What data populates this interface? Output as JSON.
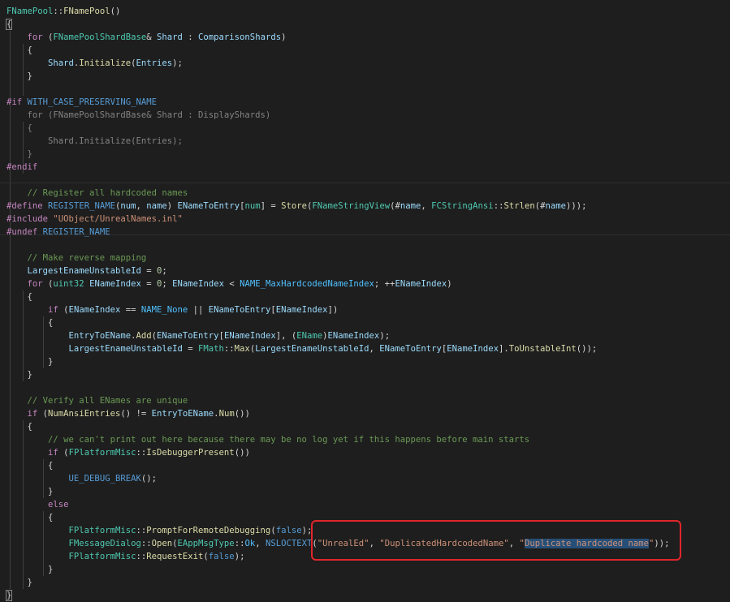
{
  "colors": {
    "background": "#1e1e1e",
    "highlight_border": "#e0262b",
    "selection": "#264f78"
  },
  "code": {
    "lines": [
      [
        {
          "t": "FNamePool",
          "c": "type"
        },
        {
          "t": "::",
          "c": "punc"
        },
        {
          "t": "FNamePool",
          "c": "fn"
        },
        {
          "t": "()",
          "c": "punc"
        }
      ],
      [
        {
          "t": "{",
          "c": "punc",
          "cursor": true
        }
      ],
      [
        {
          "t": "    "
        },
        {
          "t": "for",
          "c": "ctl"
        },
        {
          "t": " ("
        },
        {
          "t": "FNamePoolShardBase",
          "c": "type"
        },
        {
          "t": "& "
        },
        {
          "t": "Shard",
          "c": "var"
        },
        {
          "t": " : "
        },
        {
          "t": "ComparisonShards",
          "c": "var"
        },
        {
          "t": ")"
        }
      ],
      [
        {
          "t": "    {"
        }
      ],
      [
        {
          "t": "        "
        },
        {
          "t": "Shard",
          "c": "var"
        },
        {
          "t": "."
        },
        {
          "t": "Initialize",
          "c": "fn"
        },
        {
          "t": "("
        },
        {
          "t": "Entries",
          "c": "var"
        },
        {
          "t": ");"
        }
      ],
      [
        {
          "t": "    }"
        }
      ],
      [],
      [
        {
          "t": "#if",
          "c": "pre"
        },
        {
          "t": " WITH_CASE_PRESERVING_NAME",
          "c": "mac"
        }
      ],
      [
        {
          "t": "    for (FNamePoolShardBase& Shard : DisplayShards)",
          "dim": true
        }
      ],
      [
        {
          "t": "    {",
          "dim": true
        }
      ],
      [
        {
          "t": "        Shard.Initialize(Entries);",
          "dim": true
        }
      ],
      [
        {
          "t": "    }",
          "dim": true
        }
      ],
      [
        {
          "t": "#endif",
          "c": "pre"
        }
      ],
      [],
      [
        {
          "t": "    "
        },
        {
          "t": "// Register all hardcoded names",
          "c": "com"
        }
      ],
      [
        {
          "t": "#define",
          "c": "pre"
        },
        {
          "t": " "
        },
        {
          "t": "REGISTER_NAME",
          "c": "mac"
        },
        {
          "t": "("
        },
        {
          "t": "num",
          "c": "param"
        },
        {
          "t": ", "
        },
        {
          "t": "name",
          "c": "param"
        },
        {
          "t": ") "
        },
        {
          "t": "ENameToEntry",
          "c": "var"
        },
        {
          "t": "["
        },
        {
          "t": "num",
          "c": "type"
        },
        {
          "t": "] = "
        },
        {
          "t": "Store",
          "c": "fn"
        },
        {
          "t": "("
        },
        {
          "t": "FNameStringView",
          "c": "type"
        },
        {
          "t": "(#"
        },
        {
          "t": "name",
          "c": "param"
        },
        {
          "t": ", "
        },
        {
          "t": "FCStringAnsi",
          "c": "type"
        },
        {
          "t": "::"
        },
        {
          "t": "Strlen",
          "c": "fn"
        },
        {
          "t": "(#"
        },
        {
          "t": "name",
          "c": "param"
        },
        {
          "t": ")));"
        }
      ],
      [
        {
          "t": "#include",
          "c": "pre"
        },
        {
          "t": " "
        },
        {
          "t": "\"UObject/UnrealNames.inl\"",
          "c": "str"
        }
      ],
      [
        {
          "t": "#undef",
          "c": "pre"
        },
        {
          "t": " REGISTER_NAME",
          "c": "mac"
        }
      ],
      [],
      [
        {
          "t": "    "
        },
        {
          "t": "// Make reverse mapping",
          "c": "com"
        }
      ],
      [
        {
          "t": "    "
        },
        {
          "t": "LargestEnameUnstableId",
          "c": "var"
        },
        {
          "t": " = "
        },
        {
          "t": "0",
          "c": "num"
        },
        {
          "t": ";"
        }
      ],
      [
        {
          "t": "    "
        },
        {
          "t": "for",
          "c": "ctl"
        },
        {
          "t": " ("
        },
        {
          "t": "uint32",
          "c": "type"
        },
        {
          "t": " "
        },
        {
          "t": "ENameIndex",
          "c": "var"
        },
        {
          "t": " = "
        },
        {
          "t": "0",
          "c": "num"
        },
        {
          "t": "; "
        },
        {
          "t": "ENameIndex",
          "c": "var"
        },
        {
          "t": " < "
        },
        {
          "t": "NAME_MaxHardcodedNameIndex",
          "c": "enum"
        },
        {
          "t": "; ++"
        },
        {
          "t": "ENameIndex",
          "c": "var"
        },
        {
          "t": ")"
        }
      ],
      [
        {
          "t": "    {"
        }
      ],
      [
        {
          "t": "        "
        },
        {
          "t": "if",
          "c": "ctl"
        },
        {
          "t": " ("
        },
        {
          "t": "ENameIndex",
          "c": "var"
        },
        {
          "t": " == "
        },
        {
          "t": "NAME_None",
          "c": "enum"
        },
        {
          "t": " || "
        },
        {
          "t": "ENameToEntry",
          "c": "var"
        },
        {
          "t": "["
        },
        {
          "t": "ENameIndex",
          "c": "var"
        },
        {
          "t": "])"
        }
      ],
      [
        {
          "t": "        {"
        }
      ],
      [
        {
          "t": "            "
        },
        {
          "t": "EntryToEName",
          "c": "var"
        },
        {
          "t": "."
        },
        {
          "t": "Add",
          "c": "fn"
        },
        {
          "t": "("
        },
        {
          "t": "ENameToEntry",
          "c": "var"
        },
        {
          "t": "["
        },
        {
          "t": "ENameIndex",
          "c": "var"
        },
        {
          "t": "], ("
        },
        {
          "t": "EName",
          "c": "type"
        },
        {
          "t": ")"
        },
        {
          "t": "ENameIndex",
          "c": "var"
        },
        {
          "t": ");"
        }
      ],
      [
        {
          "t": "            "
        },
        {
          "t": "LargestEnameUnstableId",
          "c": "var"
        },
        {
          "t": " = "
        },
        {
          "t": "FMath",
          "c": "type"
        },
        {
          "t": "::"
        },
        {
          "t": "Max",
          "c": "fn"
        },
        {
          "t": "("
        },
        {
          "t": "LargestEnameUnstableId",
          "c": "var"
        },
        {
          "t": ", "
        },
        {
          "t": "ENameToEntry",
          "c": "var"
        },
        {
          "t": "["
        },
        {
          "t": "ENameIndex",
          "c": "var"
        },
        {
          "t": "]."
        },
        {
          "t": "ToUnstableInt",
          "c": "fn"
        },
        {
          "t": "());"
        }
      ],
      [
        {
          "t": "        }"
        }
      ],
      [
        {
          "t": "    }"
        }
      ],
      [],
      [
        {
          "t": "    "
        },
        {
          "t": "// Verify all ENames are unique",
          "c": "com"
        }
      ],
      [
        {
          "t": "    "
        },
        {
          "t": "if",
          "c": "ctl"
        },
        {
          "t": " ("
        },
        {
          "t": "NumAnsiEntries",
          "c": "fn"
        },
        {
          "t": "() != "
        },
        {
          "t": "EntryToEName",
          "c": "var"
        },
        {
          "t": "."
        },
        {
          "t": "Num",
          "c": "fn"
        },
        {
          "t": "())"
        }
      ],
      [
        {
          "t": "    {"
        }
      ],
      [
        {
          "t": "        "
        },
        {
          "t": "// we can't print out here because there may be no log yet if this happens before main starts",
          "c": "com"
        }
      ],
      [
        {
          "t": "        "
        },
        {
          "t": "if",
          "c": "ctl"
        },
        {
          "t": " ("
        },
        {
          "t": "FPlatformMisc",
          "c": "type"
        },
        {
          "t": "::"
        },
        {
          "t": "IsDebuggerPresent",
          "c": "fn"
        },
        {
          "t": "())"
        }
      ],
      [
        {
          "t": "        {"
        }
      ],
      [
        {
          "t": "            "
        },
        {
          "t": "UE_DEBUG_BREAK",
          "c": "mac"
        },
        {
          "t": "();"
        }
      ],
      [
        {
          "t": "        }"
        }
      ],
      [
        {
          "t": "        "
        },
        {
          "t": "else",
          "c": "ctl"
        }
      ],
      [
        {
          "t": "        {"
        }
      ],
      [
        {
          "t": "            "
        },
        {
          "t": "FPlatformMisc",
          "c": "type"
        },
        {
          "t": "::"
        },
        {
          "t": "PromptForRemoteDebugging",
          "c": "fn"
        },
        {
          "t": "("
        },
        {
          "t": "false",
          "c": "kw"
        },
        {
          "t": ");"
        }
      ],
      [
        {
          "t": "            "
        },
        {
          "t": "FMessageDialog",
          "c": "type"
        },
        {
          "t": "::"
        },
        {
          "t": "Open",
          "c": "fn"
        },
        {
          "t": "("
        },
        {
          "t": "EAppMsgType",
          "c": "type"
        },
        {
          "t": "::"
        },
        {
          "t": "Ok",
          "c": "enum"
        },
        {
          "t": ", "
        },
        {
          "t": "NSLOCTEXT",
          "c": "mac"
        },
        {
          "t": "("
        },
        {
          "t": "\"UnrealEd\"",
          "c": "str"
        },
        {
          "t": ", "
        },
        {
          "t": "\"DuplicatedHardcodedName\"",
          "c": "str"
        },
        {
          "t": ", "
        },
        {
          "t": "\"",
          "c": "str"
        },
        {
          "t": "Duplicate hardcoded name",
          "c": "str",
          "sel": true
        },
        {
          "t": "\"",
          "c": "str"
        },
        {
          "t": "));"
        }
      ],
      [
        {
          "t": "            "
        },
        {
          "t": "FPlatformMisc",
          "c": "type"
        },
        {
          "t": "::"
        },
        {
          "t": "RequestExit",
          "c": "fn"
        },
        {
          "t": "("
        },
        {
          "t": "false",
          "c": "kw"
        },
        {
          "t": ");"
        }
      ],
      [
        {
          "t": "        }"
        }
      ],
      [
        {
          "t": "    }"
        }
      ],
      [
        {
          "t": "}",
          "cursor": true
        }
      ]
    ]
  }
}
